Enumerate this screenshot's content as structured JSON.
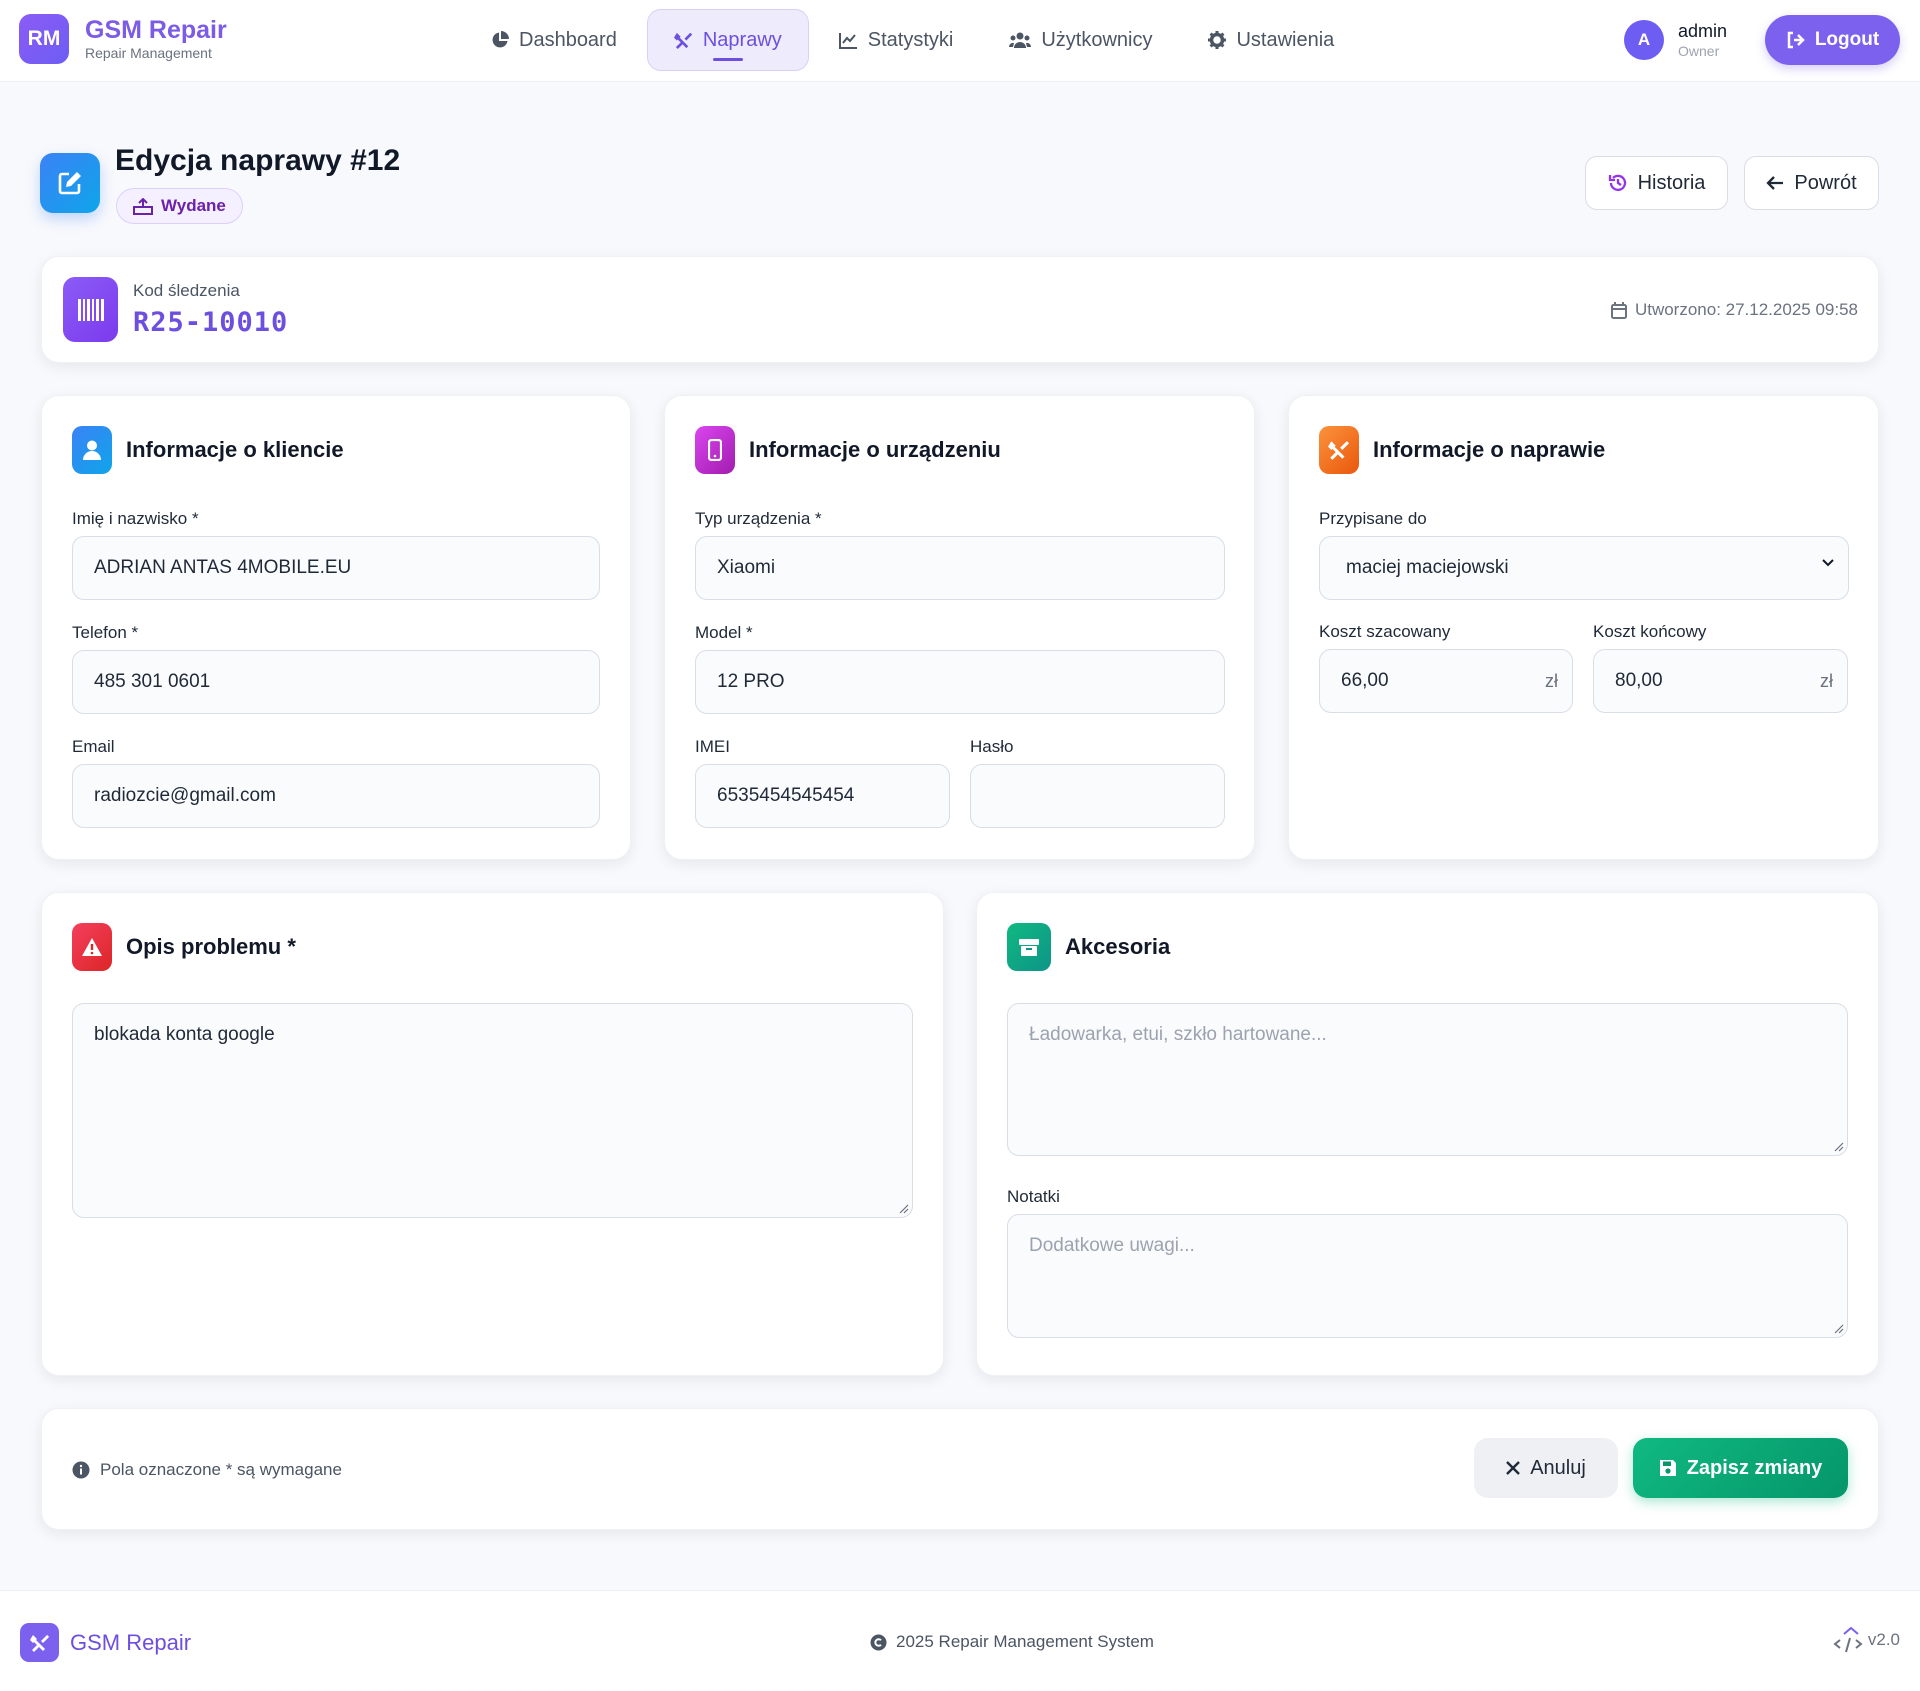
{
  "brand": {
    "logo": "RM",
    "title": "GSM Repair",
    "subtitle": "Repair Management"
  },
  "nav": [
    {
      "label": "Dashboard",
      "icon": "chart-pie-icon"
    },
    {
      "label": "Naprawy",
      "icon": "tools-icon",
      "active": true
    },
    {
      "label": "Statystyki",
      "icon": "chart-line-icon"
    },
    {
      "label": "Użytkownicy",
      "icon": "users-icon"
    },
    {
      "label": "Ustawienia",
      "icon": "gear-icon"
    }
  ],
  "user": {
    "initial": "A",
    "name": "admin",
    "role": "Owner",
    "logout": "Logout"
  },
  "page": {
    "title": "Edycja naprawy #12",
    "status": "Wydane",
    "history": "Historia",
    "back": "Powrót"
  },
  "tracking": {
    "label": "Kod śledzenia",
    "code": "R25-10010",
    "created": "Utworzono: 27.12.2025 09:58"
  },
  "client": {
    "title": "Informacje o kliencie",
    "name_label": "Imię i nazwisko *",
    "name": "ADRIAN ANTAS 4MOBILE.EU",
    "phone_label": "Telefon *",
    "phone": "485 301 0601",
    "email_label": "Email",
    "email": "radiozcie@gmail.com"
  },
  "device": {
    "title": "Informacje o urządzeniu",
    "type_label": "Typ urządzenia *",
    "type": "Xiaomi",
    "model_label": "Model *",
    "model": "12 PRO",
    "imei_label": "IMEI",
    "imei": "6535454545454",
    "password_label": "Hasło",
    "password": ""
  },
  "repair": {
    "title": "Informacje o naprawie",
    "assigned_label": "Przypisane do",
    "assigned": "maciej maciejowski",
    "est_label": "Koszt szacowany",
    "est": "66,00",
    "final_label": "Koszt końcowy",
    "final": "80,00",
    "currency": "zł"
  },
  "problem": {
    "title": "Opis problemu *",
    "text": "blokada konta google"
  },
  "accessories": {
    "title": "Akcesoria",
    "placeholder": "Ładowarka, etui, szkło hartowane...",
    "notes_label": "Notatki",
    "notes_placeholder": "Dodatkowe uwagi..."
  },
  "actions": {
    "note": "Pola oznaczone * są wymagane",
    "cancel": "Anuluj",
    "save": "Zapisz zmiany"
  },
  "footer": {
    "brand": "GSM Repair",
    "copyright": "2025 Repair Management System",
    "version": "v2.0"
  },
  "colors": {
    "accent": "#7b61ee",
    "success": "#10b981",
    "client_icon": "#3b82f6",
    "device_icon": "#c026d3",
    "repair_icon": "#f97316",
    "problem_icon": "#ef4444",
    "accessories_icon": "#10b981"
  }
}
